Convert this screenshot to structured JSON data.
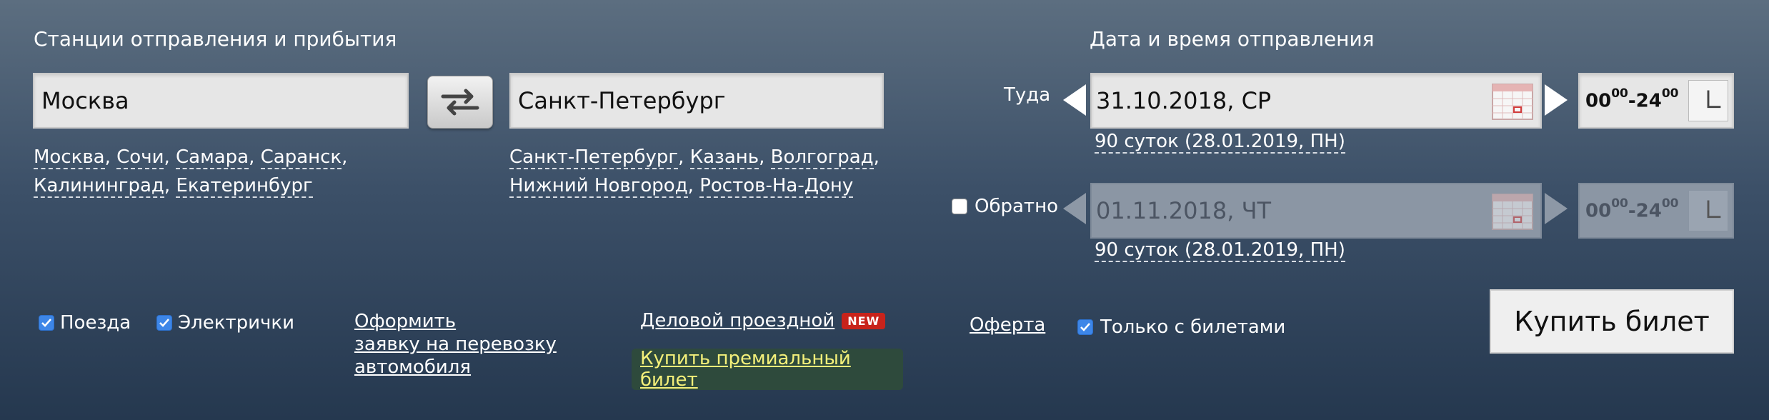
{
  "stations": {
    "heading": "Станции отправления и прибытия",
    "from_value": "Москва",
    "to_value": "Санкт-Петербург",
    "from_quick_row1": [
      "Москва",
      "Сочи",
      "Самара",
      "Саранск"
    ],
    "from_quick_row2": [
      "Калининград",
      "Екатеринбург"
    ],
    "to_quick_row1": [
      "Санкт-Петербург",
      "Казань",
      "Волгоград"
    ],
    "to_quick_row2": [
      "Нижний Новгород",
      "Ростов-На-Дону"
    ],
    "swap_icon": "swap-arrows-icon"
  },
  "datetime": {
    "heading": "Дата и время отправления",
    "outbound": {
      "label": "Туда",
      "date": "31.10.2018, СР",
      "hint": "90 суток (28.01.2019, ПН)",
      "time_from": "00",
      "time_from_sup": "00",
      "time_to": "24",
      "time_to_sup": "00"
    },
    "return": {
      "label": "Обратно",
      "checked": false,
      "date": "01.11.2018, ЧТ",
      "hint": "90 суток (28.01.2019, ПН)",
      "time_from": "00",
      "time_from_sup": "00",
      "time_to": "24",
      "time_to_sup": "00"
    }
  },
  "options": {
    "trains": {
      "label": "Поезда",
      "checked": true
    },
    "suburban": {
      "label": "Электрички",
      "checked": true
    },
    "car_request": [
      "Оформить",
      "заявку на перевозку",
      "автомобиля"
    ],
    "business_pass": "Деловой проездной",
    "new_badge": "NEW",
    "premium": "Купить премиальный билет",
    "offer": "Оферта",
    "only_with_tickets": {
      "label": "Только с билетами",
      "checked": true
    },
    "buy_button": "Купить билет"
  },
  "colors": {
    "checkbox_accent": "#3d86e8",
    "premium_link": "#f4f07a",
    "new_badge": "#c8231b"
  }
}
